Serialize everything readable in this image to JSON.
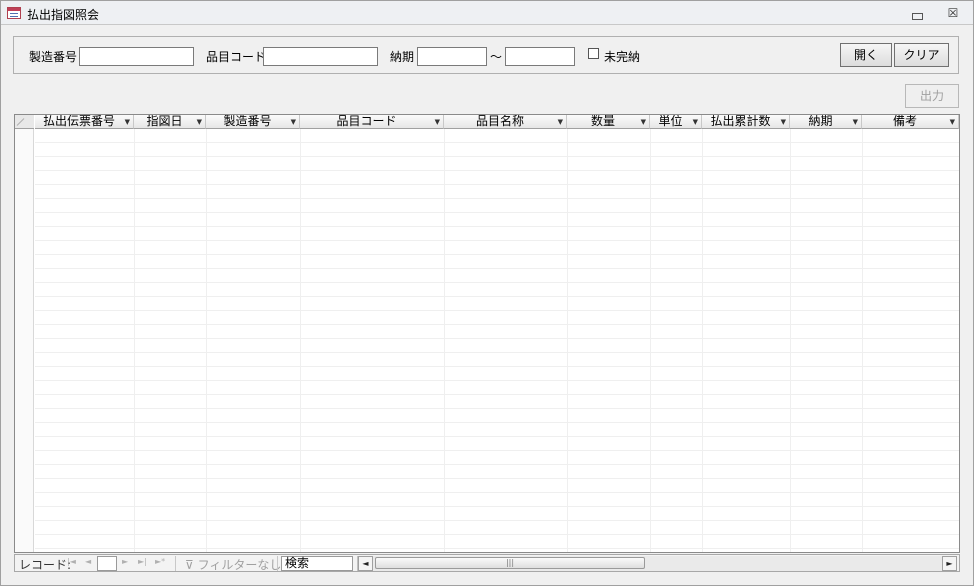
{
  "window": {
    "title": "払出指図照会",
    "close_glyph": "☒"
  },
  "criteria": {
    "seizo_label": "製造番号",
    "seizo_value": "",
    "hinmoku_label": "品目コード",
    "hinmoku_value": "",
    "noki_label": "納期",
    "noki_from": "",
    "tilde": "～",
    "noki_to": "",
    "mikan_label": "未完納",
    "mikan_checked": false,
    "open_button": "開く",
    "clear_button": "クリア"
  },
  "output_button": "出力",
  "datasheet": {
    "columns": [
      {
        "label": "払出伝票番号"
      },
      {
        "label": "指図日"
      },
      {
        "label": "製造番号"
      },
      {
        "label": "品目コード"
      },
      {
        "label": "品目名称"
      },
      {
        "label": "数量"
      },
      {
        "label": "単位"
      },
      {
        "label": "払出累計数"
      },
      {
        "label": "納期"
      },
      {
        "label": "備考"
      }
    ],
    "dropdown_glyph": "▼"
  },
  "nav": {
    "record_label": "レコード:",
    "first_glyph": "|◄",
    "prev_glyph": "◄",
    "next_glyph": "►",
    "last_glyph": "►|",
    "new_glyph": "►*",
    "filter_label": "フィルターなし",
    "search_label": "検索",
    "scroll_left": "◄",
    "scroll_right": "►",
    "thumb_glyph": "|||"
  }
}
